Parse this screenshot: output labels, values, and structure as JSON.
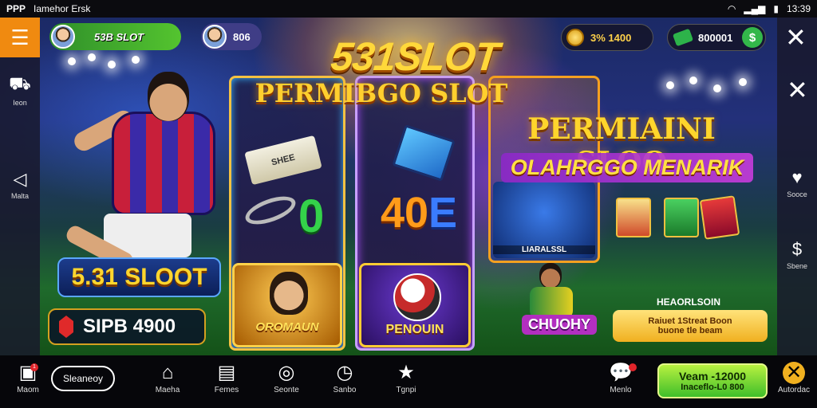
{
  "status_bar": {
    "left_text": "PPP",
    "app_text": "Iamehor Ersk",
    "time": "13:39"
  },
  "top": {
    "slot_pill": "53B SLOT",
    "num_pill": "806",
    "coins": "3% 1400",
    "cash": "800001",
    "cash_icon": "$"
  },
  "titles": {
    "main": "531SLOT",
    "sub": "PERMIBGO SLOT",
    "right_line1": "PERMIAINI SLOO",
    "right_line2": "OLAHRGGO MENARIK"
  },
  "left_rail": {
    "items": [
      {
        "icon": "basket-icon",
        "label": "Ieon"
      },
      {
        "icon": "bell-icon",
        "label": "Malta"
      }
    ]
  },
  "right_rail": {
    "items": [
      {
        "icon": "heart-icon",
        "label": "Sooce"
      },
      {
        "icon": "dollar-icon",
        "label": "Sbene"
      }
    ]
  },
  "reels": {
    "ticket": "SHEE",
    "zero": "0",
    "num40": "40",
    "numE": "E",
    "tile_a": "OROMAUN",
    "tile_b": "PENOUIN",
    "col3_label": "LIARALSSL"
  },
  "promo": {
    "badge_title": "5.31 SLOOT",
    "price": "SIPB 4900",
    "ghost": "CHUOHY",
    "promo_title": "HEAORLSOIN",
    "promo_line1": "Raiuet 1Streat Boon",
    "promo_line2": "buone tle beam"
  },
  "bottom_nav": {
    "items": [
      {
        "label": "Maom",
        "icon": "home-icon"
      },
      {
        "label": "Maeha",
        "icon": "house-icon"
      },
      {
        "label": "Femes",
        "icon": "book-icon"
      },
      {
        "label": "Seonte",
        "icon": "wreath-icon"
      },
      {
        "label": "Sanbo",
        "icon": "clock-icon"
      },
      {
        "label": "Tgnpi",
        "icon": "star-icon"
      },
      {
        "label": "Menlo",
        "icon": "chat-icon"
      },
      {
        "label": "Autordac",
        "icon": "crossed-icon"
      }
    ],
    "search_label": "Sleaneoy",
    "notif_count": "1",
    "deposit_line1": "Veam -12000",
    "deposit_line2": "Inaceflo-L0 800"
  }
}
